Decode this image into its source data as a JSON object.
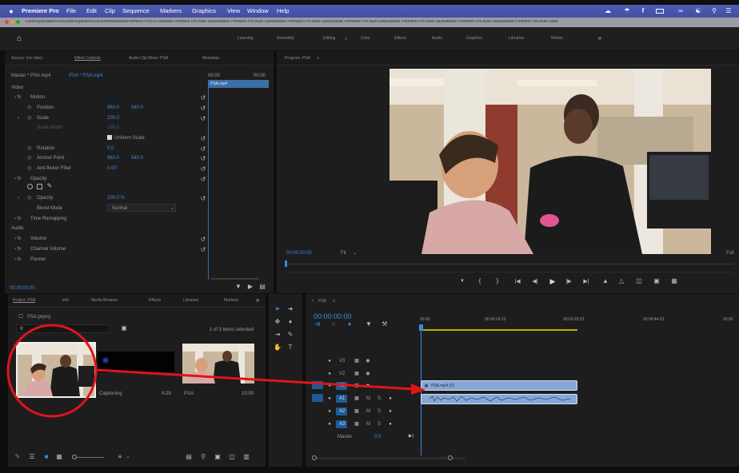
{
  "menubar": {
    "app": "Premiere Pro",
    "items": [
      "File",
      "Edit",
      "Clip",
      "Sequence",
      "Markers",
      "Graphics",
      "View",
      "Window",
      "Help"
    ]
  },
  "path_bar": "/Users/joshuakerr/Documents/jawkerr/Documents/Adobe/Premiere Pro/15.0/Adobe Premiere Pro Auto-Save/Adobe Premiere Pro Auto-Save/Adobe Premiere Pro Auto-Save/Adobe Premiere Pro Auto-Save/Adobe Premiere Pro Auto-Save/Adobe Premiere Pro Auto-Save/Adobe Premiere Pro Auto-Save",
  "workspaces": {
    "items": [
      "Learning",
      "Assembly",
      "Editing",
      "Color",
      "Effects",
      "Audio",
      "Graphics",
      "Libraries",
      "Motion"
    ],
    "active": "Editing"
  },
  "effect_controls": {
    "tabs": [
      "Source: (no clips)",
      "Effect Controls",
      "Audio Clip Mixer: PSA",
      "Metadata"
    ],
    "master_label": "Master * PSA.mp4",
    "clip_label": "PSA * PSA.mp4",
    "time_start": "00:00",
    "time_end": "00:00",
    "clip_bar": "PSA.mp4",
    "section_video": "Video",
    "motion": "Motion",
    "position": {
      "label": "Position",
      "x": "960.0",
      "y": "540.0"
    },
    "scale": {
      "label": "Scale",
      "value": "100.0"
    },
    "scale_width": {
      "label": "Scale Width",
      "value": "100.0"
    },
    "uniform_scale": "Uniform Scale",
    "rotation": {
      "label": "Rotation",
      "value": "0.0"
    },
    "anchor_point": {
      "label": "Anchor Point",
      "x": "960.0",
      "y": "540.0"
    },
    "anti_flicker": {
      "label": "Anti-flicker Filter",
      "value": "0.00"
    },
    "opacity": "Opacity",
    "opacity_row": {
      "label": "Opacity",
      "value": "100.0 %"
    },
    "blend_mode": {
      "label": "Blend Mode",
      "value": "Normal"
    },
    "time_remapping": "Time Remapping",
    "section_audio": "Audio",
    "volume": "Volume",
    "channel_volume": "Channel Volume",
    "panner": "Panner",
    "timecode": "00:00:00:00"
  },
  "program_monitor": {
    "title": "Program: PSA",
    "timecode": "00:00:00:00",
    "fit": "Fit",
    "full": "Full"
  },
  "project": {
    "tabs": [
      "Project: PSA",
      "Info",
      "Media Browser",
      "Effects",
      "Libraries",
      "Markers"
    ],
    "project_file": "PSA.prproj",
    "selected_info": "1 of 3 items selected",
    "items": [
      {
        "name": "",
        "duration": ""
      },
      {
        "name": "Captioning",
        "duration": "4:29"
      },
      {
        "name": "PSA",
        "duration": "10:00"
      }
    ]
  },
  "timeline": {
    "sequence": "PSA",
    "timecode": "00:00:00:00",
    "ruler": [
      "00:00",
      "00:00:14:23",
      "00:00:29:23",
      "00:00:44:22",
      "00:00"
    ],
    "video_tracks": [
      "V3",
      "V2",
      "V1"
    ],
    "audio_tracks": [
      "A1",
      "A2",
      "A3"
    ],
    "v1_clip": "PSA.mp4 [V]",
    "a1_clip": "",
    "master": "Master",
    "master_value": "0.0"
  },
  "colors": {
    "menubar": "#4a55ab",
    "accent": "#2d8ceb",
    "annotation": "#e0141c",
    "clip_blue": "#87a8d6",
    "track_button": "#1b5c98"
  }
}
